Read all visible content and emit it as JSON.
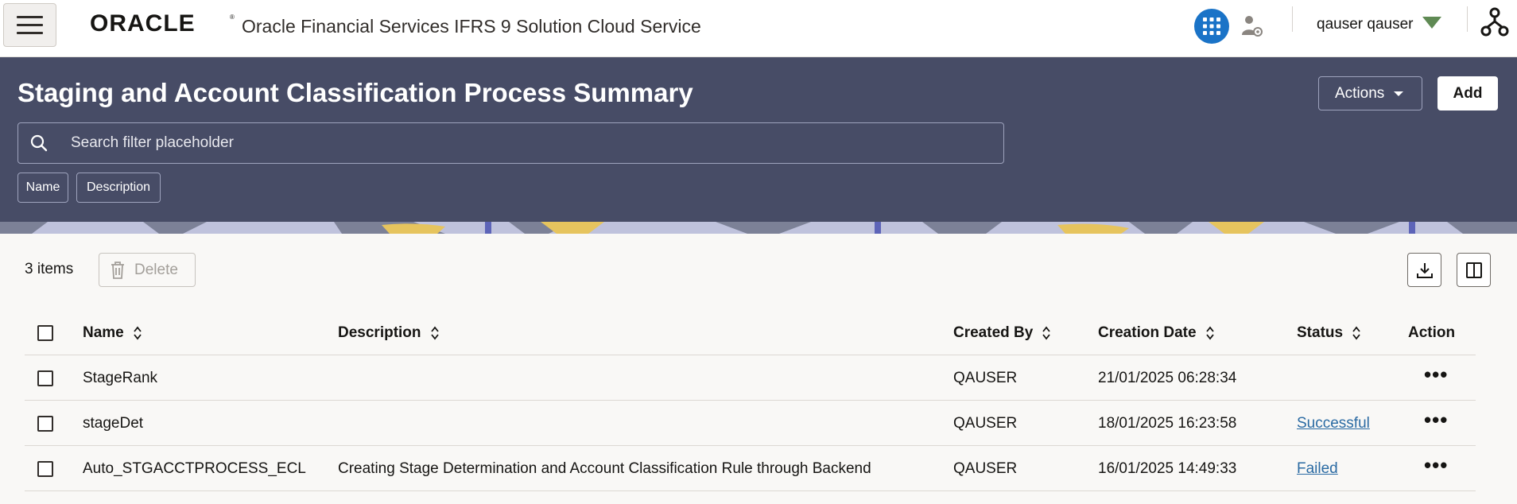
{
  "header": {
    "brand": "ORACLE",
    "app_title": "Oracle Financial Services IFRS 9 Solution Cloud Service",
    "user_name": "qauser qauser",
    "accent_color": "#1a73c7"
  },
  "banner": {
    "title": "Staging and Account Classification Process Summary",
    "actions_label": "Actions",
    "add_label": "Add",
    "search_placeholder": "Search filter placeholder",
    "chips": [
      "Name",
      "Description"
    ],
    "background_color": "#474c66"
  },
  "toolbar": {
    "items_count": "3 items",
    "delete_label": "Delete",
    "icons": [
      "download-icon",
      "columns-icon"
    ]
  },
  "table": {
    "columns": [
      "Name",
      "Description",
      "Created By",
      "Creation Date",
      "Status",
      "Action"
    ],
    "rows": [
      {
        "name": "StageRank",
        "description": "",
        "created_by": "QAUSER",
        "creation_date": "21/01/2025 06:28:34",
        "status": ""
      },
      {
        "name": "stageDet",
        "description": "",
        "created_by": "QAUSER",
        "creation_date": "18/01/2025 16:23:58",
        "status": "Successful"
      },
      {
        "name": "Auto_STGACCTPROCESS_ECL",
        "description": "Creating Stage Determination and Account Classification Rule through Backend",
        "created_by": "QAUSER",
        "creation_date": "16/01/2025 14:49:33",
        "status": "Failed"
      }
    ],
    "action_icon": "more-horizontal-icon"
  }
}
